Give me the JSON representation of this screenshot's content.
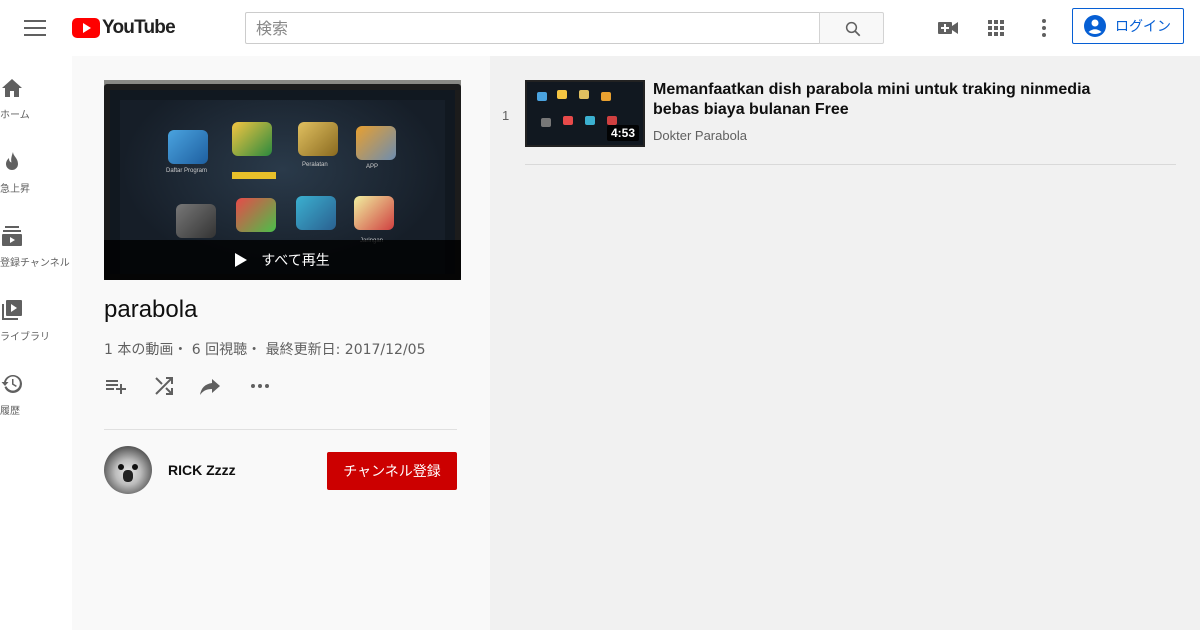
{
  "header": {
    "logo_text": "YouTube",
    "search_placeholder": "検索",
    "login_label": "ログイン"
  },
  "guide": {
    "items": [
      {
        "label": "ホーム",
        "icon": "home-icon"
      },
      {
        "label": "急上昇",
        "icon": "trending-icon"
      },
      {
        "label": "登録チャンネル",
        "icon": "subscriptions-icon"
      },
      {
        "label": "ライブラリ",
        "icon": "library-icon"
      },
      {
        "label": "履歴",
        "icon": "history-icon"
      }
    ]
  },
  "playlist": {
    "play_all_label": "すべて再生",
    "title": "parabola",
    "stats": "1 本の動画・ 6 回視聴・ 最終更新日: 2017/12/05",
    "owner": "RICK Zzzz",
    "subscribe_label": "チャンネル登録"
  },
  "videos": [
    {
      "index": "1",
      "duration": "4:53",
      "title": "Memanfaatkan dish parabola mini untuk traking ninmedia bebas biaya bulanan Free",
      "channel": "Dokter Parabola"
    }
  ],
  "thumbnail_labels": {
    "a": "Daftar Program",
    "b": "Peralatan",
    "c": "APP",
    "d": "Jaringan"
  },
  "colors": {
    "brand_red": "#ff0000",
    "subscribe_red": "#cc0000",
    "link_blue": "#065fd4",
    "left_panel_bg": "#f9f9f9",
    "right_panel_bg": "#f1f1f1"
  }
}
